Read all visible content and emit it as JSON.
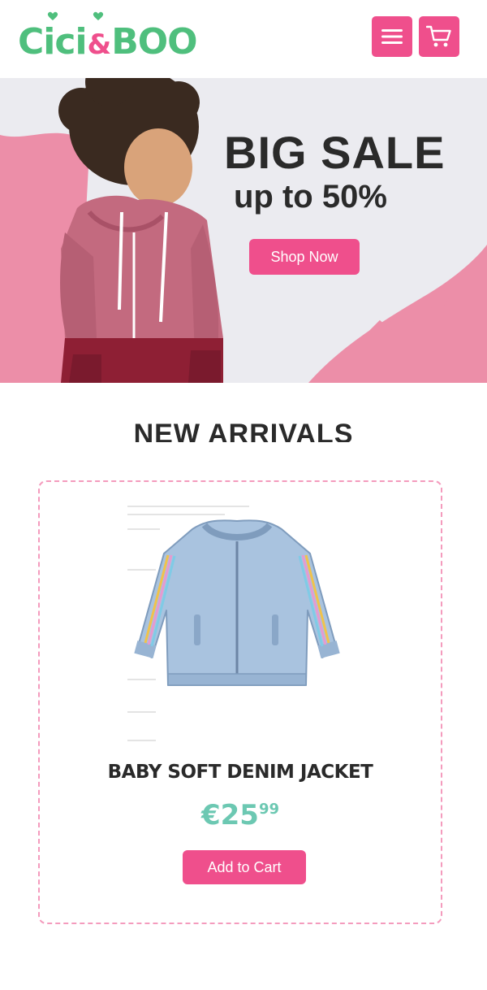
{
  "header": {
    "logo": {
      "part1": "Cici",
      "amp": "&",
      "part2": "BOO"
    },
    "menu_icon": "hamburger-menu-icon",
    "cart_icon": "shopping-cart-icon"
  },
  "hero": {
    "title": "BIG SALE",
    "subtitle": "up to 50%",
    "button_label": "Shop Now"
  },
  "new_arrivals": {
    "title": "NEW ARRIVALS"
  },
  "product": {
    "name": "BABY SOFT DENIM JACKET",
    "price_main": "€25",
    "price_cents": "99",
    "button_label": "Add to Cart"
  },
  "colors": {
    "brand_pink": "#ef4f8c",
    "brand_green": "#4fbf7d",
    "price_teal": "#6cc8b2",
    "card_border": "#f49bbd"
  }
}
